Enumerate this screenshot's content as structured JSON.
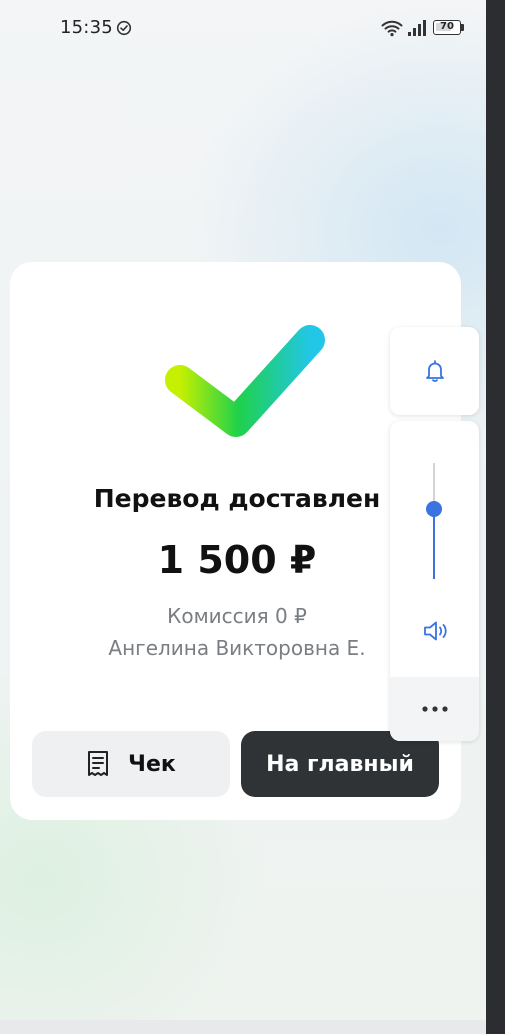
{
  "status_bar": {
    "time": "15:35",
    "battery_level": "70",
    "battery_percent": 70
  },
  "result": {
    "title": "Перевод доставлен",
    "amount": "1 500 ₽",
    "fee": "Комиссия 0 ₽",
    "recipient": "Ангелина Викторовна Е.",
    "icon": "success-check-icon"
  },
  "actions": {
    "receipt_label": "Чек",
    "home_label": "На главный"
  },
  "volume_panel": {
    "level_percent": 60,
    "icons": [
      "bell-icon",
      "speaker-icon",
      "more-dots-icon"
    ]
  },
  "colors": {
    "check_gradient_start": "#c5f000",
    "check_gradient_mid": "#1fd14b",
    "check_gradient_end": "#22c6e6",
    "slider_accent": "#3b73e0",
    "primary_button": "#2f3336",
    "secondary_button": "#eef0f1"
  }
}
